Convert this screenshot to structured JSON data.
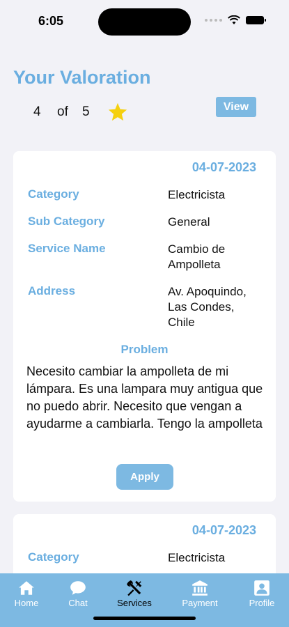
{
  "status_bar": {
    "time": "6:05"
  },
  "valoration": {
    "title": "Your Valoration",
    "rating": "4",
    "of": "of",
    "max": "5",
    "star_color": "#f5d00f",
    "view_label": "View"
  },
  "cards": [
    {
      "date": "04-07-2023",
      "category_label": "Category",
      "category": "Electricista",
      "subcategory_label": "Sub Category",
      "subcategory": "General",
      "service_label": "Service Name",
      "service": "Cambio de Ampolleta",
      "address_label": "Address",
      "address": "Av. Apoquindo, Las Condes, Chile",
      "problem_label": "Problem",
      "problem": "Necesito cambiar la ampolleta de mi lámpara. Es una lampara muy antigua que no puedo abrir. Necesito que vengan a ayudarme a cambiarla. Tengo la ampolleta",
      "apply_label": "Apply"
    },
    {
      "date": "04-07-2023",
      "category_label": "Category",
      "category": "Electricista"
    }
  ],
  "tabs": [
    {
      "label": "Home",
      "icon": "home-icon"
    },
    {
      "label": "Chat",
      "icon": "chat-icon"
    },
    {
      "label": "Services",
      "icon": "tools-icon",
      "active": true
    },
    {
      "label": "Payment",
      "icon": "bank-icon"
    },
    {
      "label": "Profile",
      "icon": "profile-icon"
    }
  ],
  "colors": {
    "accent": "#6aaee0",
    "button": "#7db9e2",
    "background": "#f2f2f7"
  }
}
